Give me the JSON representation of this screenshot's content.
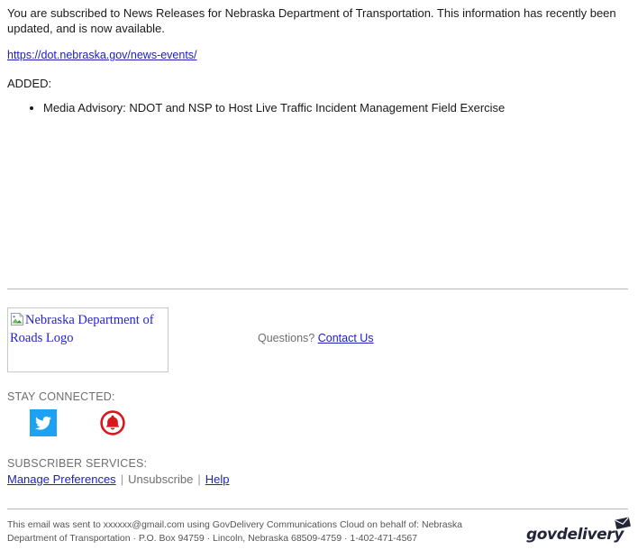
{
  "message": {
    "intro": "You are subscribed to News Releases for Nebraska Department of Transportation. This information has recently been updated, and is now available.",
    "url_text": "https://dot.nebraska.gov/news-events/",
    "added_label": "ADDED:",
    "added_items": [
      "Media Advisory: NDOT and NSP to Host Live Traffic Incident Management Field Exercise"
    ]
  },
  "footer": {
    "logo_alt": "Nebraska Department of Roads Logo",
    "questions_label": "Questions?",
    "contact_us_label": "Contact Us",
    "stay_connected_label": "STAY CONNECTED:",
    "social": [
      {
        "name": "twitter-icon",
        "label": "Twitter",
        "color": "#1da1f2"
      },
      {
        "name": "notification-bell-icon",
        "label": "Email Updates",
        "color": "#d9181e"
      }
    ],
    "subscriber_services_label": "SUBSCRIBER SERVICES:",
    "links": {
      "manage_preferences": "Manage Preferences",
      "separator": "|",
      "unsubscribe": "Unsubscribe",
      "help": "Help"
    }
  },
  "legal": {
    "line1": "This email was sent to xxxxxx@gmail.com using GovDelivery Communications Cloud on behalf of: Nebraska Department of",
    "line2": "Transportation · P.O. Box 94759 · Lincoln, Nebraska 68509-4759 · 1-402-471-4567",
    "brand_name": "govdelivery"
  },
  "colors": {
    "link": "#2020bb",
    "muted_text": "#6f6f6f",
    "divider": "#b8b8b8",
    "twitter_blue": "#1da1f2",
    "bell_red": "#d9181e",
    "govdelivery_navy": "#23253a"
  }
}
